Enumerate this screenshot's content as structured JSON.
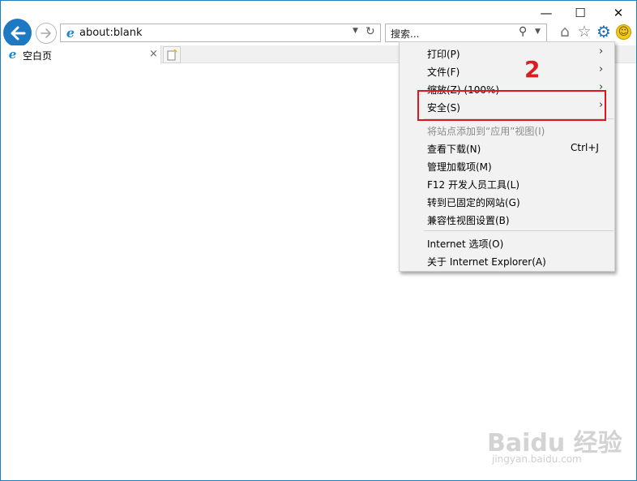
{
  "window_controls": {
    "minimize": "—",
    "maximize": "☐",
    "close": "✕"
  },
  "toolbar": {
    "address": "about:blank",
    "search_placeholder": "搜索...",
    "icons": [
      "back-arrow-icon",
      "forward-arrow-icon",
      "ie-logo-icon",
      "refresh-icon",
      "search-icon",
      "home-icon",
      "star-icon",
      "gear-icon",
      "smile-icon"
    ]
  },
  "tab": {
    "title": "空白页",
    "close_glyph": "×"
  },
  "menu": {
    "items": [
      {
        "label": "打印(P)",
        "arrow": "›"
      },
      {
        "label": "文件(F)",
        "arrow": "›"
      },
      {
        "label": "缩放(Z) (100%)",
        "arrow": "›"
      },
      {
        "label": "安全(S)",
        "arrow": "›"
      },
      {
        "label": "将站点添加到“应用”视图(I)",
        "disabled": true
      },
      {
        "label": "查看下载(N)",
        "shortcut": "Ctrl+J"
      },
      {
        "label": "管理加载项(M)"
      },
      {
        "label": "F12 开发人员工具(L)"
      },
      {
        "label": "转到已固定的网站(G)"
      },
      {
        "label": "兼容性视图设置(B)"
      },
      {
        "label": "Internet 选项(O)"
      },
      {
        "label": "关于 Internet Explorer(A)"
      }
    ]
  },
  "annotation": {
    "step": "2",
    "color": "#e0161b"
  },
  "watermark": {
    "logo": "Baidu 经验",
    "url": "jingyan.baidu.com"
  }
}
